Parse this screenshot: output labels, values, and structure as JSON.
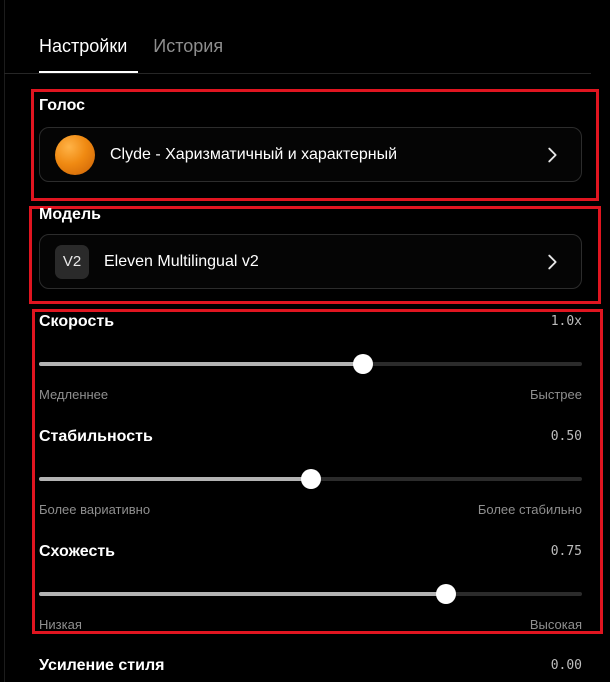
{
  "tabs": [
    {
      "label": "Настройки",
      "active": true
    },
    {
      "label": "История",
      "active": false
    }
  ],
  "voice": {
    "title": "Голос",
    "selected": "Clyde - Харизматичный и характерный",
    "avatar_color": "#f08a12"
  },
  "model": {
    "title": "Модель",
    "badge": "V2",
    "selected": "Eleven Multilingual v2"
  },
  "sliders": [
    {
      "title": "Скорость",
      "value_text": "1.0x",
      "fraction": 0.596,
      "min_label": "Медленнее",
      "max_label": "Быстрее"
    },
    {
      "title": "Стабильность",
      "value_text": "0.50",
      "fraction": 0.5,
      "min_label": "Более вариативно",
      "max_label": "Более стабильно"
    },
    {
      "title": "Схожесть",
      "value_text": "0.75",
      "fraction": 0.75,
      "min_label": "Низкая",
      "max_label": "Высокая"
    }
  ],
  "style_boost": {
    "title": "Усиление стиля",
    "value_text": "0.00"
  },
  "colors": {
    "highlight": "#e01520",
    "background": "#000000",
    "track": "#2b2b2b",
    "track_fill": "#b3b3b3"
  },
  "icons": {
    "chevron": "chevron-right-icon"
  }
}
